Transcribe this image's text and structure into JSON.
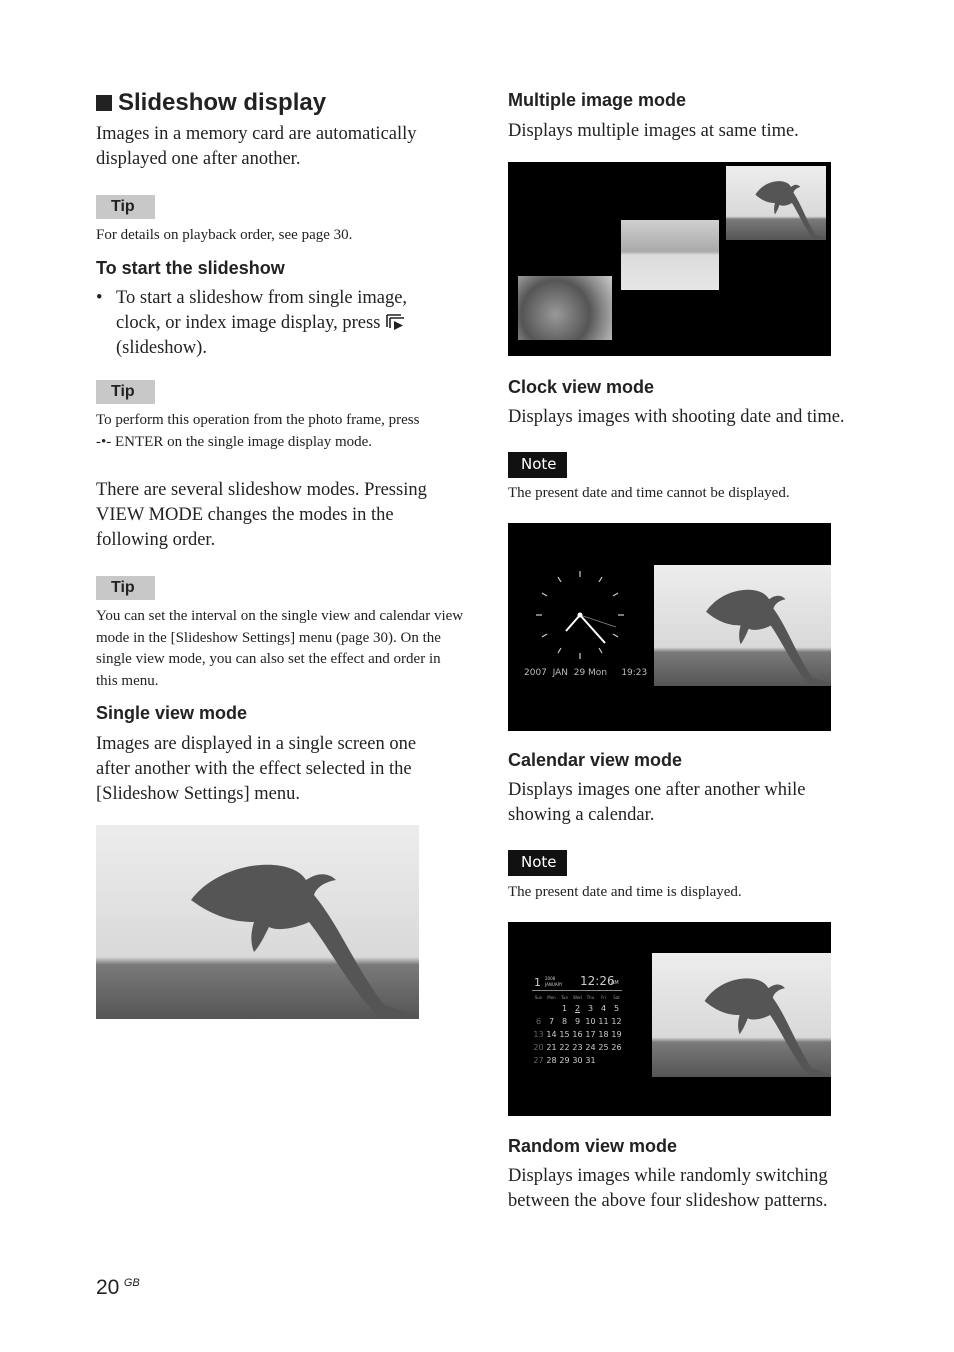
{
  "left": {
    "title": "Slideshow display",
    "intro": "Images in a memory card are automatically displayed one after another.",
    "tip_label": "Tip",
    "tip1": "For details on playback order, see page 30.",
    "start_heading": "To start the slideshow",
    "bullet_a": "To start a slideshow from single image, clock, or index image display, press",
    "bullet_b": "(slideshow).",
    "tip2_a": "To perform this operation from the photo frame, press",
    "tip2_b": "ENTER on the single image display mode.",
    "modes_text": "There are several slideshow modes. Pressing VIEW MODE changes the modes in the following order.",
    "tip3": "You can set the interval on the single view and calendar view mode in the [Slideshow Settings] menu (page 30). On the single view mode,  you can also set the effect and order in this menu.",
    "single_heading": "Single view mode",
    "single_text": "Images are displayed in a single screen one after another with the effect selected in the [Slideshow Settings] menu."
  },
  "right": {
    "multi_heading": "Multiple image mode",
    "multi_text": "Displays multiple images at same time.",
    "clock_heading": "Clock view mode",
    "clock_text": "Displays images with shooting date and time.",
    "note_label": "Note",
    "clock_note": "The present date and time cannot be displayed.",
    "clock_readout": "2007  JAN  29 Mon     19:23",
    "cal_heading": "Calendar view mode",
    "cal_text": "Displays images one after another while showing a calendar.",
    "cal_note": "The present date and time is displayed.",
    "random_heading": "Random view mode",
    "random_text": "Displays images while randomly switching between the above four slideshow patterns."
  },
  "calendar": {
    "day": "1",
    "year": "2008",
    "month": "JANUARY",
    "time": "12:26",
    "ampm": "AM",
    "weekdays": [
      "Sun",
      "Mon",
      "Tue",
      "Wed",
      "Thu",
      "Fri",
      "Sat"
    ],
    "weeks": [
      [
        "",
        "",
        "1",
        "2",
        "3",
        "4",
        "5"
      ],
      [
        "6",
        "7",
        "8",
        "9",
        "10",
        "11",
        "12"
      ],
      [
        "13",
        "14",
        "15",
        "16",
        "17",
        "18",
        "19"
      ],
      [
        "20",
        "21",
        "22",
        "23",
        "24",
        "25",
        "26"
      ],
      [
        "27",
        "28",
        "29",
        "30",
        "31",
        "",
        ""
      ]
    ]
  },
  "footer": {
    "page": "20",
    "region": "GB"
  }
}
